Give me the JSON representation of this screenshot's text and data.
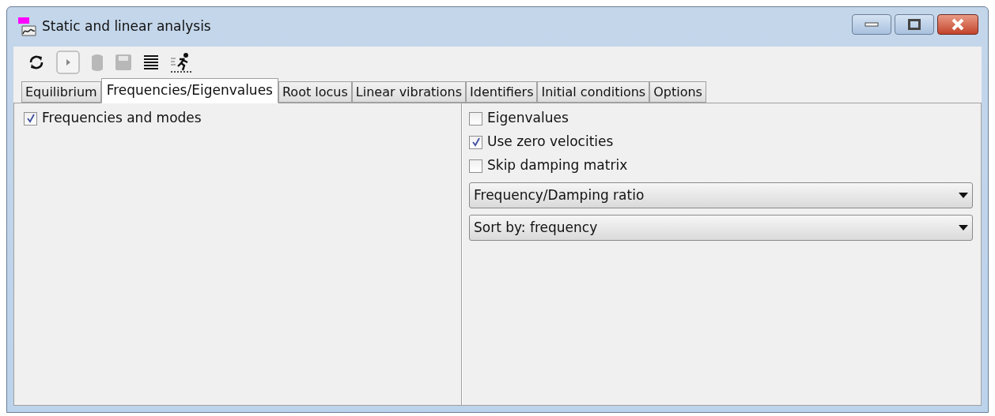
{
  "window": {
    "title": "Static and linear analysis"
  },
  "toolbar": [
    {
      "kind": "refresh",
      "disabled": false
    },
    {
      "kind": "play",
      "disabled": true
    },
    {
      "kind": "database",
      "disabled": true
    },
    {
      "kind": "save",
      "disabled": true
    },
    {
      "kind": "list",
      "disabled": false
    },
    {
      "kind": "run",
      "disabled": false
    }
  ],
  "tabs": [
    {
      "label": "Equilibrium",
      "selected": false
    },
    {
      "label": "Frequencies/Eigenvalues",
      "selected": true
    },
    {
      "label": "Root locus",
      "selected": false
    },
    {
      "label": "Linear vibrations",
      "selected": false
    },
    {
      "label": "Identifiers",
      "selected": false
    },
    {
      "label": "Initial conditions",
      "selected": false
    },
    {
      "label": "Options",
      "selected": false
    }
  ],
  "left_panel": {
    "checkboxes": [
      {
        "label": "Frequencies and modes",
        "checked": true
      }
    ]
  },
  "right_panel": {
    "checkboxes": [
      {
        "label": "Eigenvalues",
        "checked": false
      },
      {
        "label": "Use zero velocities",
        "checked": true
      },
      {
        "label": "Skip damping matrix",
        "checked": false
      }
    ],
    "dropdowns": [
      {
        "value": "Frequency/Damping ratio"
      },
      {
        "value": "Sort by: frequency"
      }
    ]
  }
}
